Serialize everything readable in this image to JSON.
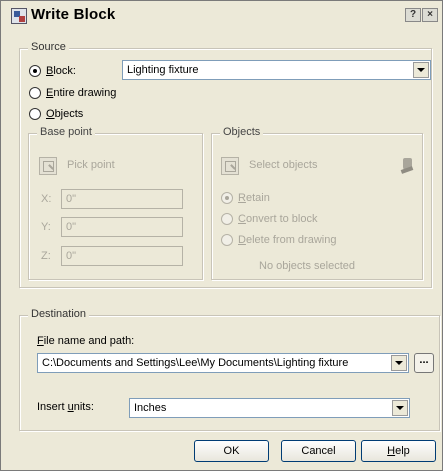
{
  "window": {
    "title": "Write Block",
    "help_btn": "?",
    "close_btn": "×"
  },
  "source": {
    "legend": "Source",
    "block_label": "Block:",
    "block_accel": "B",
    "block_rest": "lock:",
    "entire_accel": "E",
    "entire_rest": "ntire drawing",
    "objects_accel": "O",
    "objects_rest": "bjects",
    "block_value": "Lighting fixture"
  },
  "base_point": {
    "legend": "Base point",
    "pick_label": "Pick point",
    "x_label": "X:",
    "x_value": "0\"",
    "y_label": "Y:",
    "y_value": "0\"",
    "z_label": "Z:",
    "z_value": "0\""
  },
  "objects": {
    "legend": "Objects",
    "select_label": "Select objects",
    "retain_accel": "R",
    "retain_rest": "etain",
    "convert_accel": "C",
    "convert_rest": "onvert to block",
    "delete_accel": "D",
    "delete_rest": "elete from drawing",
    "status": "No objects selected"
  },
  "destination": {
    "legend": "Destination",
    "file_label_accel": "F",
    "file_label_rest": "ile name and path:",
    "file_value": "C:\\Documents and Settings\\Lee\\My Documents\\Lighting fixture",
    "browse_label": "...",
    "units_label_pre": "Insert ",
    "units_label_accel": "u",
    "units_label_post": "nits:",
    "units_value": "Inches"
  },
  "buttons": {
    "ok": "OK",
    "cancel": "Cancel",
    "help_accel": "H",
    "help_rest": "elp"
  }
}
